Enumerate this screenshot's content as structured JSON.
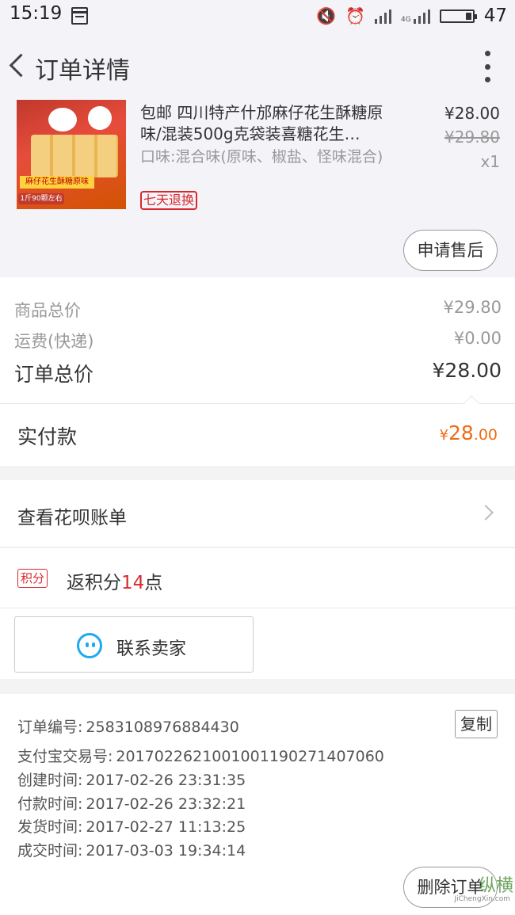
{
  "status_bar": {
    "time": "15:19",
    "network": "4G",
    "battery": "47"
  },
  "header": {
    "title": "订单详情"
  },
  "product": {
    "title": "包邮 四川特产什邡麻仔花生酥糖原味/混装500g克袋装喜糖花生…",
    "sku": "口味:混合味(原味、椒盐、怪味混合)",
    "price": "¥28.00",
    "original_price": "¥29.80",
    "qty": "x1",
    "tag": "七天退换",
    "image_badge_1": "麻仔花生酥糖原味",
    "image_badge_2": "1斤90颗左右"
  },
  "after_sale_button": "申请售后",
  "price_summary": {
    "goods_total_label": "商品总价",
    "goods_total": "¥29.80",
    "shipping_label": "运费(快递)",
    "shipping": "¥0.00",
    "order_total_label": "订单总价",
    "order_total": "¥28.00",
    "paid_label": "实付款",
    "paid_currency": "¥",
    "paid_int": "28",
    "paid_dec": ".00"
  },
  "huabei": {
    "label": "查看花呗账单"
  },
  "points": {
    "tag": "积分",
    "prefix": "返积分",
    "value": "14",
    "suffix": "点"
  },
  "contact": {
    "label": "联系卖家"
  },
  "order_info": {
    "order_no_label": "订单编号:",
    "order_no": "2583108976884430",
    "alipay_no_label": "支付宝交易号:",
    "alipay_no": "2017022621001001190271407060",
    "created_label": "创建时间:",
    "created": "2017-02-26 23:31:35",
    "paid_time_label": "付款时间:",
    "paid_time": "2017-02-26 23:32:21",
    "shipped_label": "发货时间:",
    "shipped": "2017-02-27 11:13:25",
    "completed_label": "成交时间:",
    "completed": "2017-03-03 19:34:14",
    "copy_button": "复制"
  },
  "delete_button": "删除订单",
  "watermark": {
    "text": "纵横",
    "sub": "JiChengXin.com"
  },
  "colors": {
    "accent": "#d8292f",
    "paid": "#ef6c14",
    "wangwang": "#1eaaf1"
  },
  "icons": [
    "mute-icon",
    "alarm-icon",
    "signal-icon",
    "battery-icon",
    "back-icon",
    "more-icon",
    "chevron-right-icon",
    "wangwang-icon"
  ]
}
